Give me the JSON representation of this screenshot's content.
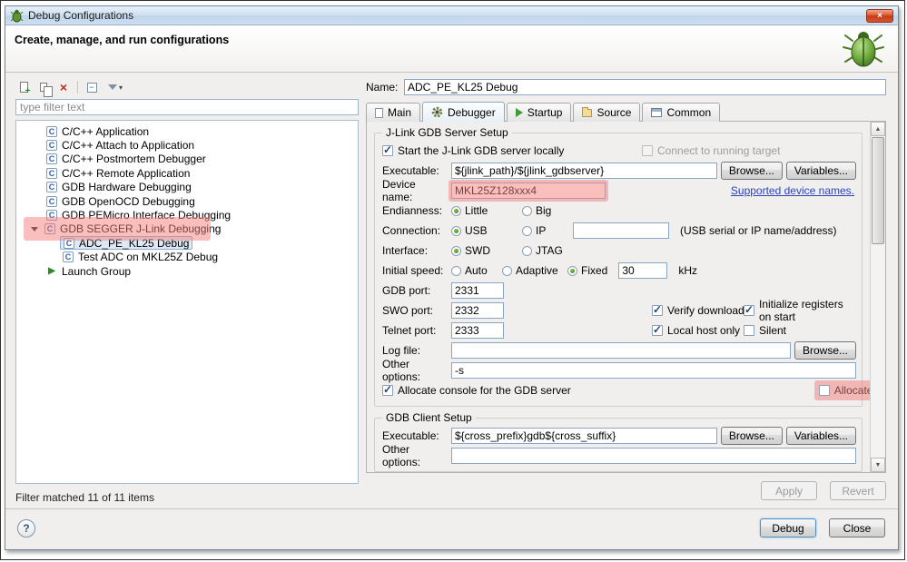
{
  "icons": {
    "close": "×",
    "delete": "×",
    "dropdown": "▾",
    "arrow_up": "▲",
    "arrow_down": "▼",
    "help": "?"
  },
  "window": {
    "title": "Debug Configurations",
    "header": "Create, manage, and run configurations"
  },
  "sidebar": {
    "filter_placeholder": "type filter text",
    "status": "Filter matched 11 of 11 items",
    "tree": [
      {
        "label": "C/C++ Application"
      },
      {
        "label": "C/C++ Attach to Application"
      },
      {
        "label": "C/C++ Postmortem Debugger"
      },
      {
        "label": "C/C++ Remote Application"
      },
      {
        "label": "GDB Hardware Debugging"
      },
      {
        "label": "GDB OpenOCD Debugging"
      },
      {
        "label": "GDB PEMicro Interface Debugging"
      },
      {
        "label": "GDB SEGGER J-Link Debugging"
      },
      {
        "label": "ADC_PE_KL25 Debug"
      },
      {
        "label": "Test ADC on MKL25Z Debug"
      },
      {
        "label": "Launch Group"
      }
    ]
  },
  "main": {
    "name_label": "Name:",
    "name_value": "ADC_PE_KL25 Debug",
    "tabs": [
      {
        "label": "Main"
      },
      {
        "label": "Debugger"
      },
      {
        "label": "Startup"
      },
      {
        "label": "Source"
      },
      {
        "label": "Common"
      }
    ],
    "server": {
      "title": "J-Link GDB Server Setup",
      "start_locally": "Start the J-Link GDB server locally",
      "connect_running": "Connect to running target",
      "executable_label": "Executable:",
      "executable_value": "${jlink_path}/${jlink_gdbserver}",
      "browse_label": "Browse...",
      "variables_label": "Variables...",
      "device_label": "Device name:",
      "device_value": "MKL25Z128xxx4",
      "supported_link": "Supported device names.",
      "endianness_label": "Endianness:",
      "endian_little": "Little",
      "endian_big": "Big",
      "connection_label": "Connection:",
      "conn_usb": "USB",
      "conn_ip": "IP",
      "conn_value": "",
      "conn_hint": "(USB serial or IP name/address)",
      "interface_label": "Interface:",
      "if_swd": "SWD",
      "if_jtag": "JTAG",
      "speed_label": "Initial speed:",
      "speed_auto": "Auto",
      "speed_adaptive": "Adaptive",
      "speed_fixed": "Fixed",
      "speed_value": "30",
      "speed_unit": "kHz",
      "gdb_port_label": "GDB port:",
      "gdb_port_value": "2331",
      "swo_port_label": "SWO port:",
      "swo_port_value": "2332",
      "verify_label": "Verify downloads",
      "init_regs_label": "Initialize registers on start",
      "telnet_port_label": "Telnet port:",
      "telnet_port_value": "2333",
      "local_host_label": "Local host only",
      "silent_label": "Silent",
      "log_label": "Log file:",
      "log_value": "",
      "other_label": "Other options:",
      "other_value": "-s",
      "alloc_server_label": "Allocate console for the GDB server",
      "alloc_semi_label": "Allocate console for semihosting and SWO"
    },
    "client": {
      "title": "GDB Client Setup",
      "executable_label": "Executable:",
      "executable_value": "${cross_prefix}gdb${cross_suffix}",
      "browse_label": "Browse...",
      "variables_label": "Variables...",
      "other_label": "Other options:",
      "other_value": ""
    },
    "apply_label": "Apply",
    "revert_label": "Revert"
  },
  "footer": {
    "debug_label": "Debug",
    "close_label": "Close"
  }
}
